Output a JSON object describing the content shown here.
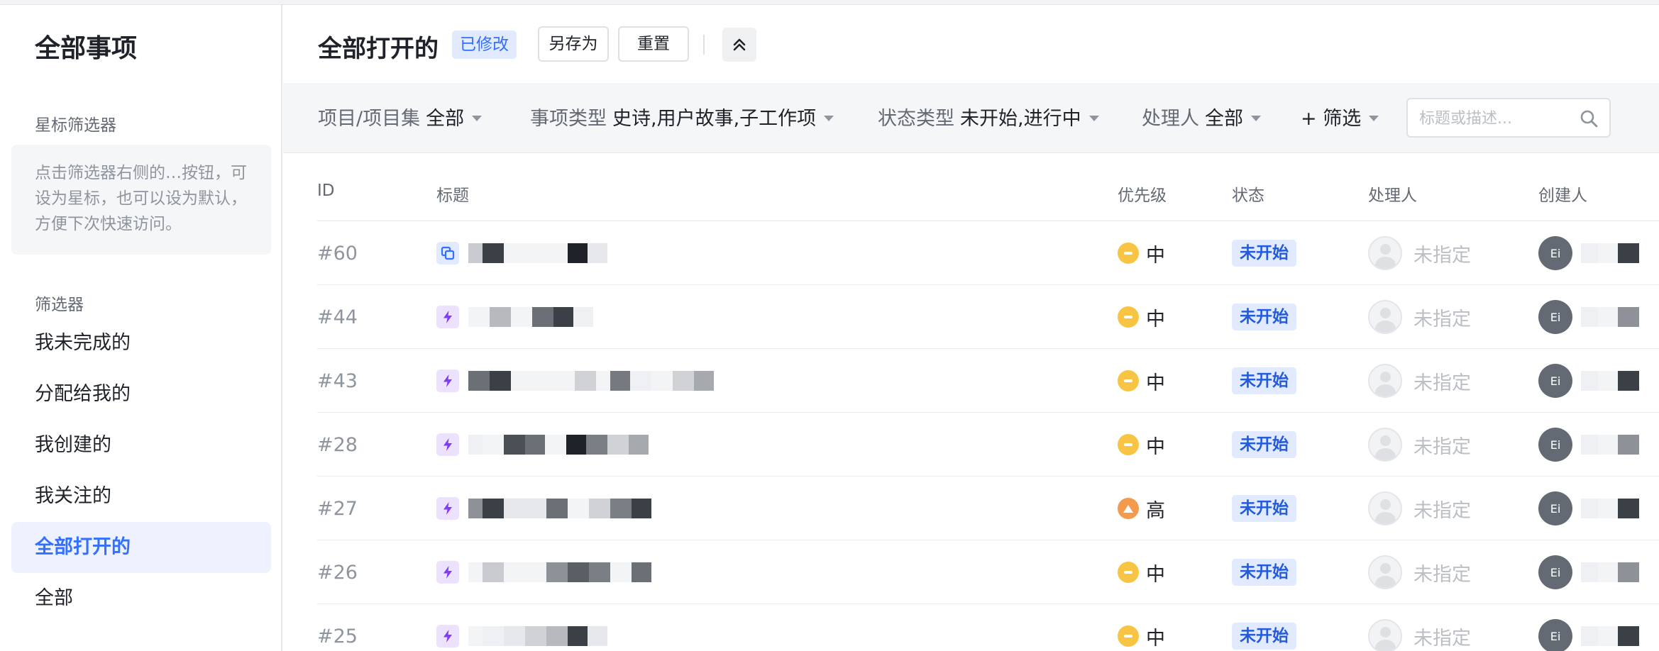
{
  "sidebar": {
    "title": "全部事项",
    "starred_section": "星标筛选器",
    "starred_hint": "点击筛选器右侧的…按钮，可设为星标，也可以设为默认，方便下次快速访问。",
    "filters_section": "筛选器",
    "items": [
      {
        "label": "我未完成的",
        "active": false
      },
      {
        "label": "分配给我的",
        "active": false
      },
      {
        "label": "我创建的",
        "active": false
      },
      {
        "label": "我关注的",
        "active": false
      },
      {
        "label": "全部打开的",
        "active": true
      },
      {
        "label": "全部",
        "active": false
      }
    ]
  },
  "header": {
    "title": "全部打开的",
    "badge": "已修改",
    "save_as": "另存为",
    "reset": "重置",
    "collapse_icon": "chevrons-up-icon"
  },
  "filters": {
    "project": {
      "key": "项目/项目集",
      "value": "全部"
    },
    "issue_type": {
      "key": "事项类型",
      "value": "史诗,用户故事,子工作项"
    },
    "status_type": {
      "key": "状态类型",
      "value": "未开始,进行中"
    },
    "assignee": {
      "key": "处理人",
      "value": "全部"
    },
    "add_filter": "+ 筛选",
    "search_placeholder": "标题或描述..."
  },
  "table": {
    "columns": {
      "id": "ID",
      "title": "标题",
      "priority": "优先级",
      "status": "状态",
      "assignee": "处理人",
      "creator": "创建人"
    },
    "rows": [
      {
        "id": "#60",
        "type_icon": "epic-icon",
        "priority": "中",
        "priority_level": "medium",
        "status": "未开始",
        "assignee": "未指定",
        "creator_initials": "Ei"
      },
      {
        "id": "#44",
        "type_icon": "story-icon",
        "priority": "中",
        "priority_level": "medium",
        "status": "未开始",
        "assignee": "未指定",
        "creator_initials": "Ei"
      },
      {
        "id": "#43",
        "type_icon": "story-icon",
        "priority": "中",
        "priority_level": "medium",
        "status": "未开始",
        "assignee": "未指定",
        "creator_initials": "Ei"
      },
      {
        "id": "#28",
        "type_icon": "story-icon",
        "priority": "中",
        "priority_level": "medium",
        "status": "未开始",
        "assignee": "未指定",
        "creator_initials": "Ei"
      },
      {
        "id": "#27",
        "type_icon": "story-icon",
        "priority": "高",
        "priority_level": "high",
        "status": "未开始",
        "assignee": "未指定",
        "creator_initials": "Ei"
      },
      {
        "id": "#26",
        "type_icon": "story-icon",
        "priority": "中",
        "priority_level": "medium",
        "status": "未开始",
        "assignee": "未指定",
        "creator_initials": "Ei"
      },
      {
        "id": "#25",
        "type_icon": "story-icon",
        "priority": "中",
        "priority_level": "medium",
        "status": "未开始",
        "assignee": "未指定",
        "creator_initials": "Ei"
      }
    ]
  },
  "colors": {
    "accent": "#3370ff",
    "badge_bg": "#e1eaff",
    "priority_medium": "#f7c543",
    "priority_high": "#f39a4b",
    "story": "#7f3bf5"
  }
}
